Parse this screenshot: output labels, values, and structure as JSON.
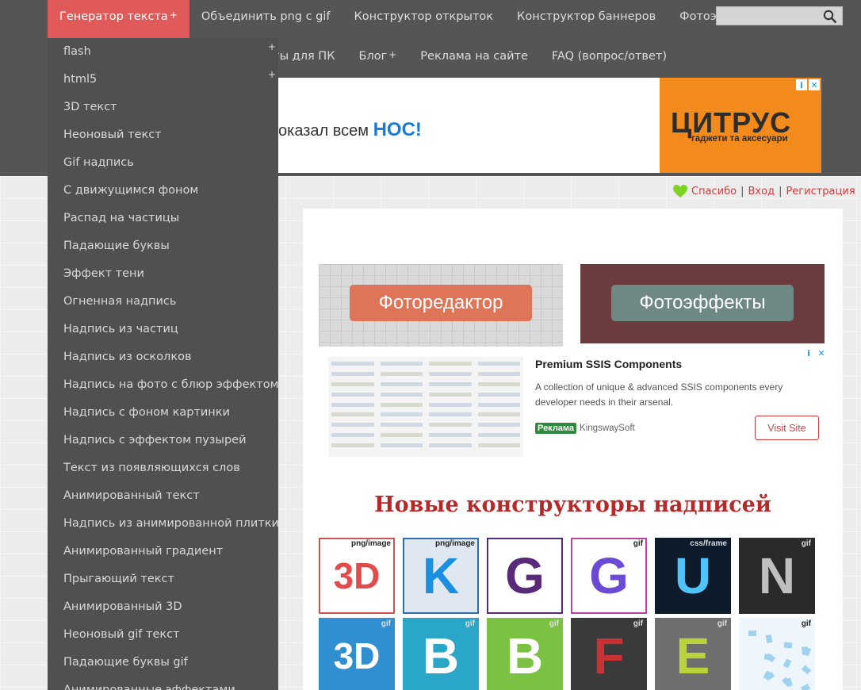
{
  "nav": {
    "primary": [
      {
        "label": "Генератор текста",
        "plus": "+",
        "active": true
      },
      {
        "label": "Объединить png с gif"
      },
      {
        "label": "Конструктор открыток"
      },
      {
        "label": "Конструктор баннеров"
      },
      {
        "label": "Фотоэффекты"
      }
    ],
    "secondary": [
      {
        "label": "гы для ПК"
      },
      {
        "label": "Блог",
        "plus": "+"
      },
      {
        "label": "Реклама на сайте"
      },
      {
        "label": "FAQ (вопрос/ответ)"
      }
    ],
    "search_placeholder": ""
  },
  "dropdown": [
    "flash",
    "html5",
    "3D текст",
    "Неоновый текст",
    "Gif надпись",
    "С движущимся фоном",
    "Распад на частицы",
    "Падающие буквы",
    "Эффект тени",
    "Огненная надпись",
    "Надпись из частиц",
    "Надпись из осколков",
    "Надпись на фото с блюр эффектом",
    "Надпись с фоном картинки",
    "Надпись с эффектом пузырей",
    "Текст из появляющихся слов",
    "Анимированный текст",
    "Надпись из анимированной плитки",
    "Анимированный градиент",
    "Прыгающий текст",
    "Анимированный 3D",
    "Неоновый gif текст",
    "Падающие буквы gif",
    "Анимированные эффектами"
  ],
  "dropdown_plus": "+",
  "ad_banner": {
    "text": "оказал всем",
    "highlight": "НОС!",
    "brand": "ЦИТРУС",
    "tagline": "гаджети та аксесуари",
    "info_icon": "i",
    "close_icon": "✕"
  },
  "user_links": {
    "thanks": "Спасибо",
    "login": "Вход",
    "register": "Регистрация",
    "separator": "|"
  },
  "promos": {
    "photo_editor": "Фоторедактор",
    "photo_effects": "Фотоэффекты"
  },
  "ssis_ad": {
    "title": "Premium SSIS Components",
    "description": "A collection of unique & advanced SSIS components every developer needs in their arsenal.",
    "badge": "Реклама",
    "advertiser": "KingswaySoft",
    "button": "Visit Site",
    "info_icon": "i",
    "close_icon": "✕"
  },
  "section_title": "Новые конструкторы надписей",
  "tiles": [
    {
      "tag": "png/image",
      "glyph": "3D",
      "bg": "#ffffff",
      "fg": "#e24b4b",
      "border": "#d05050"
    },
    {
      "tag": "png/image",
      "glyph": "K",
      "bg": "#dfe8f0",
      "fg": "#1b8fe0",
      "border": "#2f6fb0"
    },
    {
      "tag": "",
      "glyph": "G",
      "bg": "#ffffff",
      "fg": "#5a2a7a",
      "border": "#5a2a7a"
    },
    {
      "tag": "gif",
      "glyph": "G",
      "bg": "#ffffff",
      "fg": "#6b4bd6",
      "border": "#c040a0"
    },
    {
      "tag": "css/frame",
      "glyph": "U",
      "bg": "#0d1b2a",
      "fg": "#4fc3ff",
      "border": "#0d1b2a"
    },
    {
      "tag": "gif",
      "glyph": "N",
      "bg": "#2a2a2a",
      "fg": "#bfbfbf",
      "border": "#2a2a2a"
    },
    {
      "tag": "gif",
      "glyph": "3D",
      "bg": "#2f8fd0",
      "fg": "#ffffff",
      "border": "#2f8fd0"
    },
    {
      "tag": "gif",
      "glyph": "B",
      "bg": "#2aa7c8",
      "fg": "#ffffff",
      "border": "#2aa7c8"
    },
    {
      "tag": "gif",
      "glyph": "B",
      "bg": "#7cc242",
      "fg": "#ffffff",
      "border": "#7cc242"
    },
    {
      "tag": "gif",
      "glyph": "F",
      "bg": "#3a3a3a",
      "fg": "#c83232",
      "border": "#3a3a3a"
    },
    {
      "tag": "gif",
      "glyph": "E",
      "bg": "#6f6f6f",
      "fg": "#b8d43a",
      "border": "#6f6f6f"
    },
    {
      "tag": "gif",
      "glyph": "",
      "bg": "#eef6fb",
      "fg": "#9fd2ef",
      "border": "#eef6fb"
    }
  ]
}
